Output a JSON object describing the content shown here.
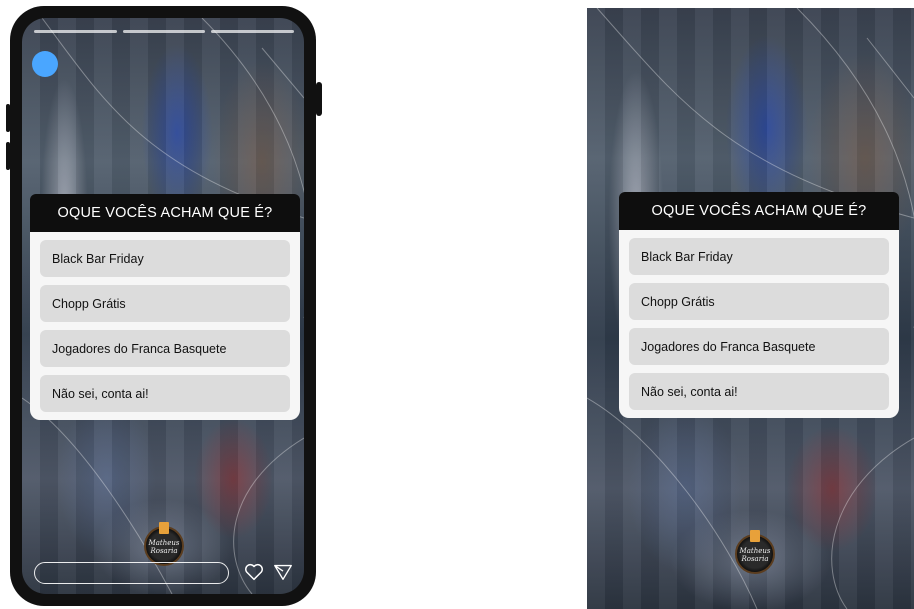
{
  "poll": {
    "question": "OQUE  VOCÊS ACHAM QUE É?",
    "options": [
      "Black Bar Friday",
      "Chopp Grátis",
      "Jogadores do Franca Basquete",
      "Não sei, conta ai!"
    ]
  },
  "logo": {
    "line1": "Matheus",
    "line2": "Rosaria"
  },
  "colors": {
    "avatar": "#4aa6ff",
    "poll_header": "#0e0e0e",
    "option_bg": "#dcdcdc"
  },
  "icons": {
    "like": "heart-icon",
    "send": "send-icon"
  }
}
